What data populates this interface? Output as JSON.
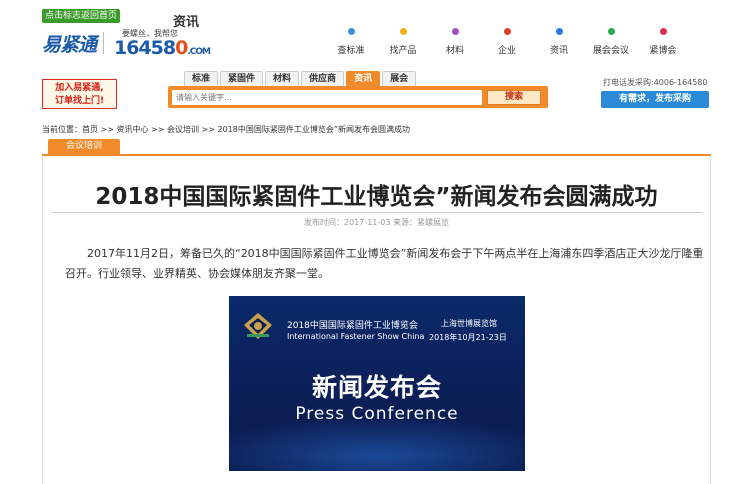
{
  "header": {
    "home_button": "点击标志返回首页",
    "logo_text": "易紧通",
    "slogan": "要螺丝，我帮您",
    "phone_logo": "16458",
    "phone_logo_tail": "0",
    "phone_logo_domain": ".COM",
    "section_title": "资讯",
    "nav": [
      {
        "label": "查标准",
        "color": "#3a8fd8"
      },
      {
        "label": "找产品",
        "color": "#f2b01a"
      },
      {
        "label": "材料",
        "color": "#a24fc2"
      },
      {
        "label": "企业",
        "color": "#e23c2a"
      },
      {
        "label": "资讯",
        "color": "#2a7ad8"
      },
      {
        "label": "展会会议",
        "color": "#2aa84a"
      },
      {
        "label": "紧博会",
        "color": "#d8305a"
      }
    ]
  },
  "promo": {
    "line1": "加入易紧通,",
    "line2": "订单找上门!"
  },
  "search": {
    "tabs": [
      "标准",
      "紧固件",
      "材料",
      "供应商",
      "资讯",
      "展会"
    ],
    "active_tab": "资讯",
    "placeholder": "请输入关键字...",
    "button": "搜索"
  },
  "hotline": "打电话发采购:4006-164580",
  "demand_button": "有需求，发布采购",
  "breadcrumb": "当前位置：首页 >> 资讯中心 >> 会议培训 >> 2018中国国际紧固件工业博览会”新闻发布会圆满成功",
  "category_tab": "会议培训",
  "article": {
    "title": "2018中国国际紧固件工业博览会”新闻发布会圆满成功",
    "meta": "发布时间：2017-11-03  来源：紧螺展览",
    "body": "2017年11月2日，筹备已久的“2018中国国际紧固件工业博览会”新闻发布会于下午两点半在上海浦东四季酒店正大沙龙厅隆重召开。行业领导、业界精英、协会媒体朋友齐聚一堂。"
  },
  "banner": {
    "expo_cn": "2018中国国际紧固件工业博览会",
    "expo_en": "International Fastener Show China",
    "venue": "上海世博展览馆",
    "dates": "2018年10月21-23日",
    "press_cn": "新闻发布会",
    "press_en": "Press Conference"
  }
}
